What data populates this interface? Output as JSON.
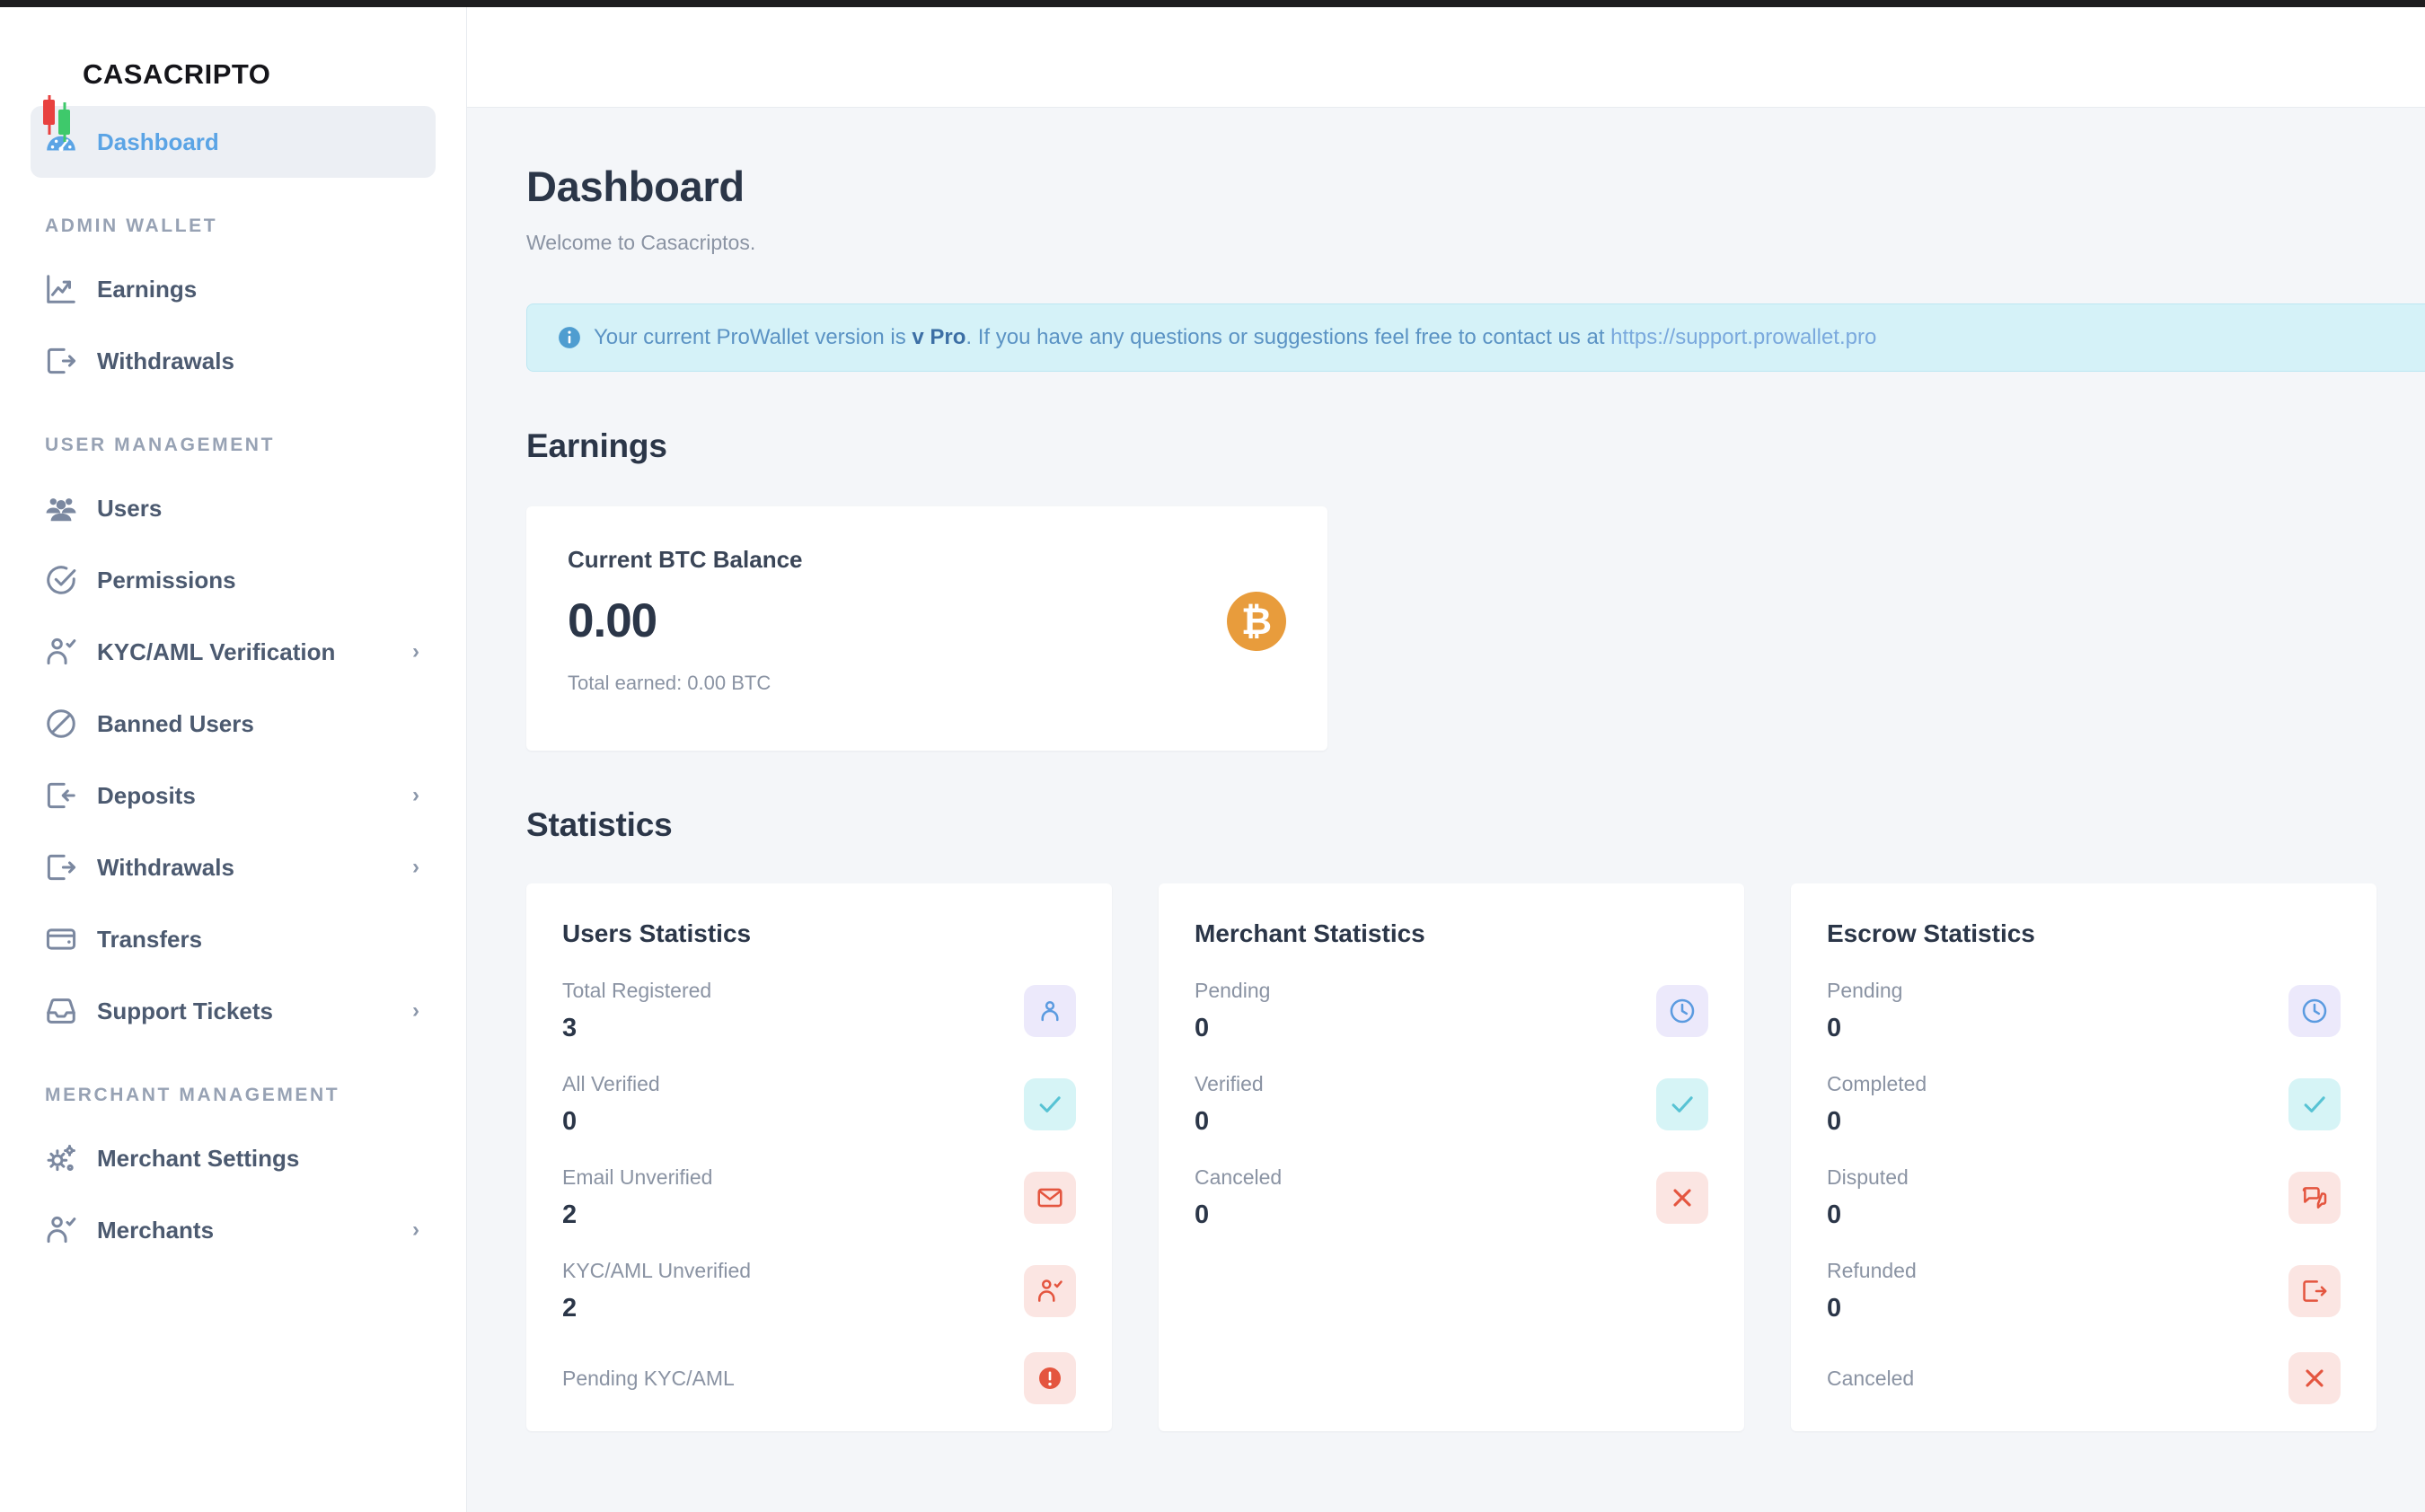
{
  "brand": {
    "name": "CASACRIPTO",
    "logo_icon": "candlestick-logo",
    "red": "#e8413f",
    "green": "#3ec96b"
  },
  "sidebar": {
    "active_item": "Dashboard",
    "groups": [
      {
        "section": null,
        "items": [
          {
            "label": "Dashboard",
            "icon": "speedometer-icon",
            "active": true,
            "chevron": false
          }
        ]
      },
      {
        "section": "ADMIN WALLET",
        "items": [
          {
            "label": "Earnings",
            "icon": "chart-up-icon",
            "active": false,
            "chevron": false
          },
          {
            "label": "Withdrawals",
            "icon": "export-arrow-icon",
            "active": false,
            "chevron": false
          }
        ]
      },
      {
        "section": "USER MANAGEMENT",
        "items": [
          {
            "label": "Users",
            "icon": "users-group-icon",
            "active": false,
            "chevron": false
          },
          {
            "label": "Permissions",
            "icon": "check-circle-icon",
            "active": false,
            "chevron": false
          },
          {
            "label": "KYC/AML Verification",
            "icon": "user-check-icon",
            "active": false,
            "chevron": true
          },
          {
            "label": "Banned Users",
            "icon": "ban-icon",
            "active": false,
            "chevron": false
          },
          {
            "label": "Deposits",
            "icon": "import-arrow-icon",
            "active": false,
            "chevron": true
          },
          {
            "label": "Withdrawals",
            "icon": "export-arrow-icon",
            "active": false,
            "chevron": true
          },
          {
            "label": "Transfers",
            "icon": "wallet-icon",
            "active": false,
            "chevron": false
          },
          {
            "label": "Support Tickets",
            "icon": "inbox-icon",
            "active": false,
            "chevron": true
          }
        ]
      },
      {
        "section": "MERCHANT MANAGEMENT",
        "items": [
          {
            "label": "Merchant Settings",
            "icon": "gears-icon",
            "active": false,
            "chevron": false
          },
          {
            "label": "Merchants",
            "icon": "user-check-icon",
            "active": false,
            "chevron": true
          }
        ]
      }
    ]
  },
  "page": {
    "title": "Dashboard",
    "subtitle": "Welcome to Casacriptos."
  },
  "alert": {
    "icon": "info-circle-icon",
    "prefix": "Your current ProWallet version is ",
    "version": "v Pro",
    "middle": ". If you have any questions or suggestions feel free to contact us at ",
    "link": "https://support.prowallet.pro"
  },
  "earnings": {
    "heading": "Earnings",
    "card": {
      "label": "Current BTC Balance",
      "value": "0.00",
      "total": "Total earned: 0.00 BTC",
      "badge_icon": "bitcoin-icon",
      "badge_glyph": "₿",
      "badge_color": "#e89c3c"
    }
  },
  "statistics": {
    "heading": "Statistics",
    "cards": [
      {
        "title": "Users Statistics",
        "rows": [
          {
            "label": "Total Registered",
            "value": "3",
            "icon": "user-icon",
            "chip": "purple"
          },
          {
            "label": "All Verified",
            "value": "0",
            "icon": "check-icon",
            "chip": "cyan"
          },
          {
            "label": "Email Unverified",
            "value": "2",
            "icon": "envelope-icon",
            "chip": "pink"
          },
          {
            "label": "KYC/AML Unverified",
            "value": "2",
            "icon": "user-check-icon",
            "chip": "pink"
          },
          {
            "label": "Pending KYC/AML",
            "value": "",
            "icon": "alert-icon",
            "chip": "pink"
          }
        ]
      },
      {
        "title": "Merchant Statistics",
        "rows": [
          {
            "label": "Pending",
            "value": "0",
            "icon": "clock-icon",
            "chip": "purple"
          },
          {
            "label": "Verified",
            "value": "0",
            "icon": "check-icon",
            "chip": "cyan"
          },
          {
            "label": "Canceled",
            "value": "0",
            "icon": "close-x-icon",
            "chip": "pink"
          }
        ]
      },
      {
        "title": "Escrow Statistics",
        "rows": [
          {
            "label": "Pending",
            "value": "0",
            "icon": "clock-icon",
            "chip": "purple"
          },
          {
            "label": "Completed",
            "value": "0",
            "icon": "check-icon",
            "chip": "cyan"
          },
          {
            "label": "Disputed",
            "value": "0",
            "icon": "chat-dispute-icon",
            "chip": "pink"
          },
          {
            "label": "Refunded",
            "value": "0",
            "icon": "export-arrow-icon",
            "chip": "pink"
          },
          {
            "label": "Canceled",
            "value": "",
            "icon": "close-x-icon",
            "chip": "pink"
          }
        ]
      }
    ]
  },
  "colors": {
    "accent": "#5ba4e5",
    "bitcoin": "#e89c3c",
    "alert_bg": "#d5f2f8",
    "page_bg": "#f4f6f9"
  }
}
